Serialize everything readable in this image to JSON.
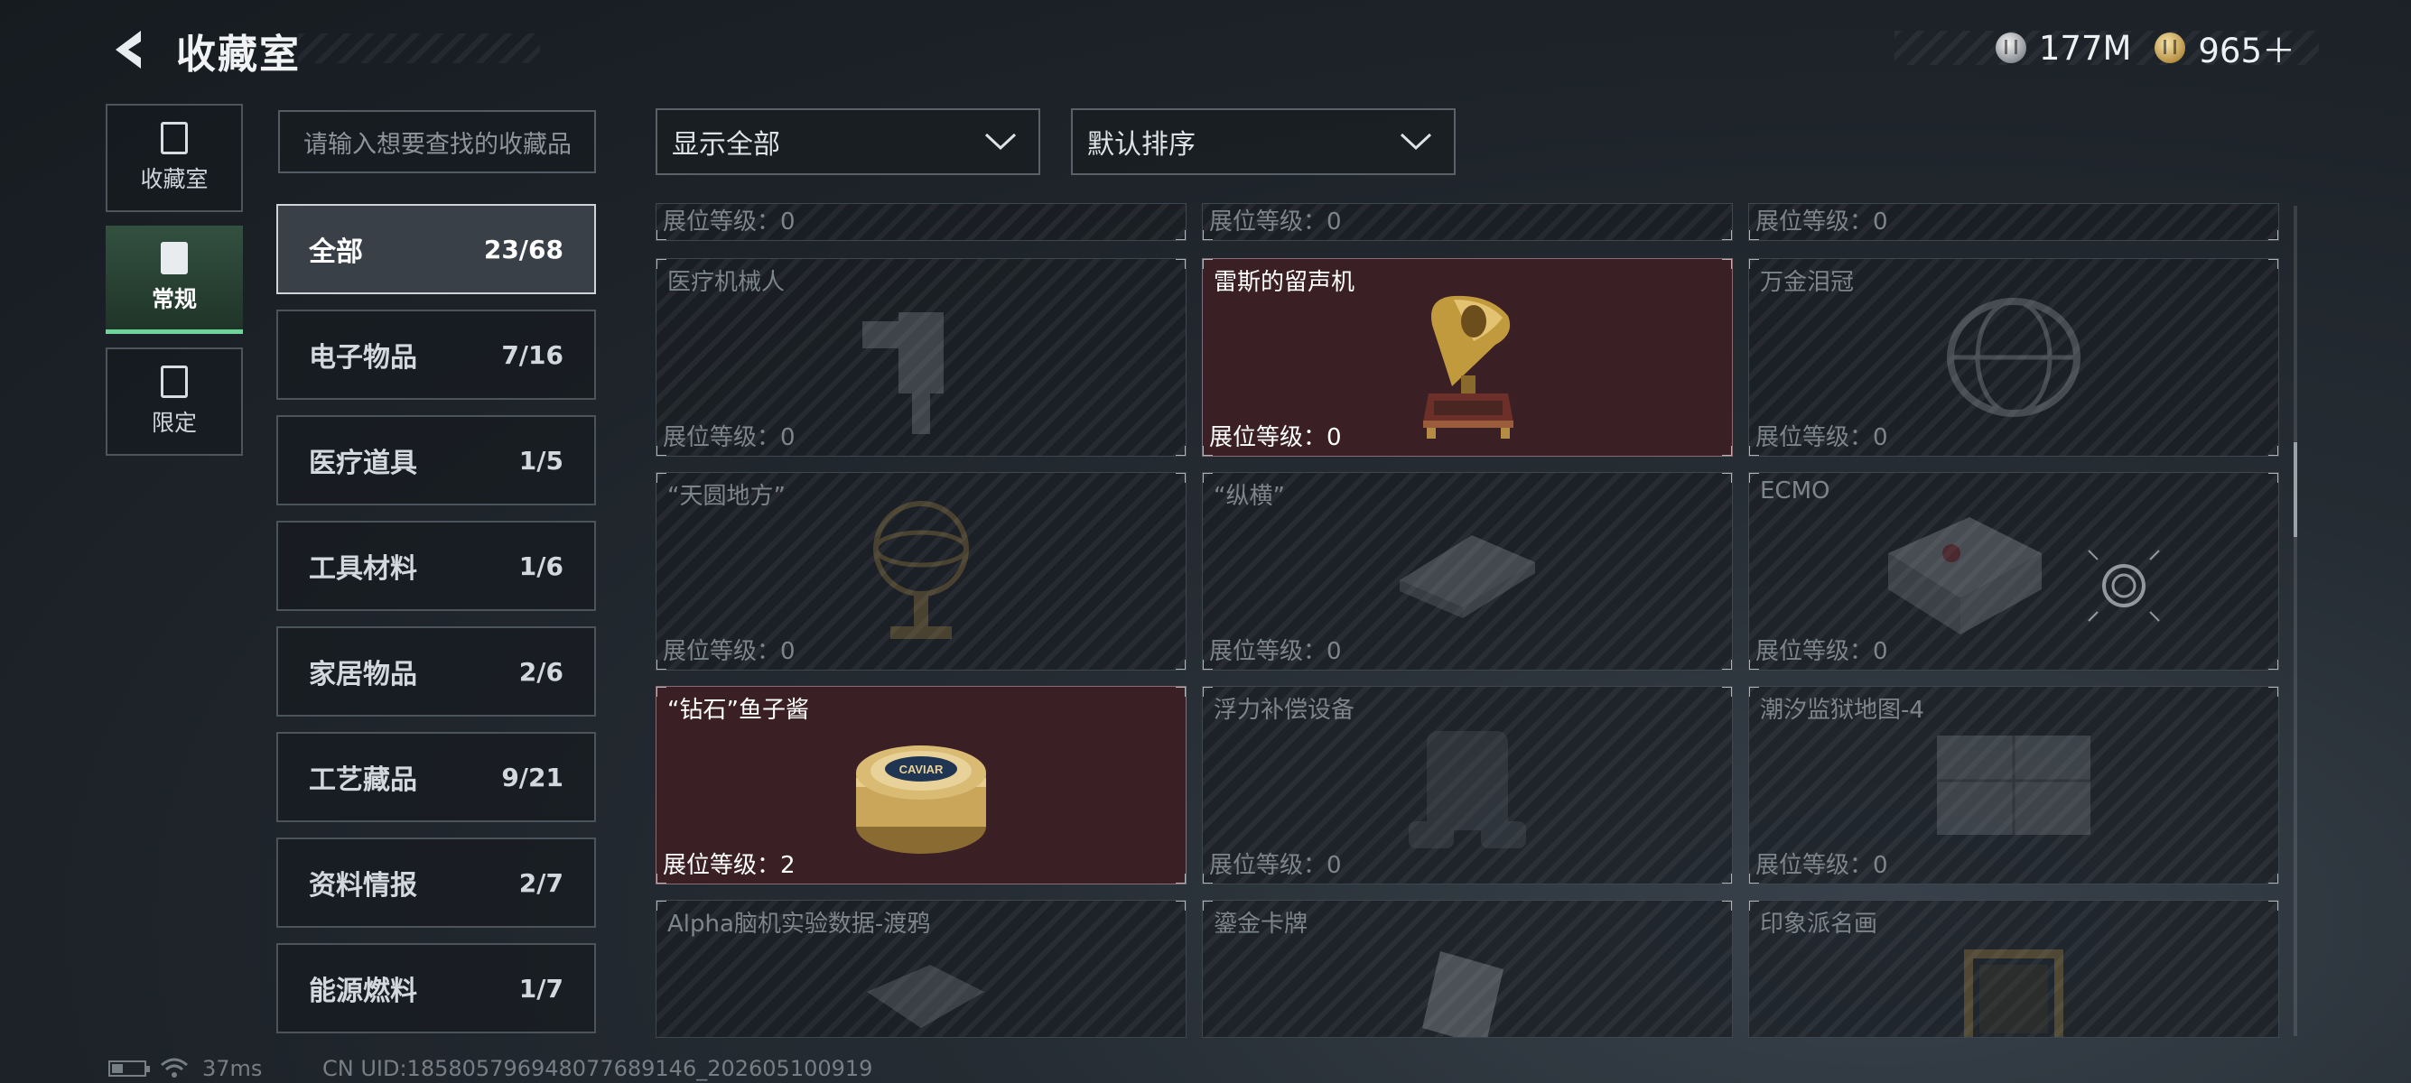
{
  "header": {
    "title": "收藏室",
    "currency": [
      {
        "icon": "silver-coin-icon",
        "value": "177M"
      },
      {
        "icon": "gold-coin-icon",
        "value": "965＋"
      }
    ]
  },
  "rail": [
    {
      "label": "收藏室",
      "icon": "collection-room-icon",
      "active": false
    },
    {
      "label": "常规",
      "icon": "regular-icon",
      "active": true
    },
    {
      "label": "限定",
      "icon": "limited-icon",
      "active": false
    }
  ],
  "search": {
    "placeholder": "请输入想要查找的收藏品"
  },
  "categories": [
    {
      "label": "全部",
      "count": "23/68",
      "active": true
    },
    {
      "label": "电子物品",
      "count": "7/16"
    },
    {
      "label": "医疗道具",
      "count": "1/5"
    },
    {
      "label": "工具材料",
      "count": "1/6"
    },
    {
      "label": "家居物品",
      "count": "2/6"
    },
    {
      "label": "工艺藏品",
      "count": "9/21"
    },
    {
      "label": "资料情报",
      "count": "2/7"
    },
    {
      "label": "能源燃料",
      "count": "1/7"
    }
  ],
  "filters": {
    "display": "显示全部",
    "sort": "默认排序"
  },
  "grid": {
    "partial_row": [
      {
        "level": "展位等级：0"
      },
      {
        "level": "展位等级：0"
      },
      {
        "level": "展位等级：0"
      }
    ],
    "rows": [
      [
        {
          "name": "医疗机械人",
          "level": "展位等级：0",
          "owned": false,
          "icon": "medical-robot-icon"
        },
        {
          "name": "雷斯的留声机",
          "level": "展位等级：0",
          "owned": true,
          "icon": "gramophone-icon"
        },
        {
          "name": "万金泪冠",
          "level": "展位等级：0",
          "owned": false,
          "icon": "crown-icon"
        }
      ],
      [
        {
          "name": "“天圆地方”",
          "level": "展位等级：0",
          "owned": false,
          "icon": "armillary-sphere-icon"
        },
        {
          "name": "“纵横”",
          "level": "展位等级：0",
          "owned": false,
          "icon": "chess-board-icon"
        },
        {
          "name": "ECMO",
          "level": "展位等级：0",
          "owned": false,
          "icon": "ecmo-machine-icon"
        }
      ],
      [
        {
          "name": "“钻石”鱼子酱",
          "level": "展位等级：2",
          "owned": true,
          "icon": "caviar-tin-icon",
          "tin_text": "CAVIAR"
        },
        {
          "name": "浮力补偿设备",
          "level": "展位等级：0",
          "owned": false,
          "icon": "buoyancy-device-icon"
        },
        {
          "name": "潮汐监狱地图-4",
          "level": "展位等级：0",
          "owned": false,
          "icon": "map-icon"
        }
      ],
      [
        {
          "name": "Alpha脑机实验数据-渡鸦",
          "owned": false,
          "icon": "data-device-icon"
        },
        {
          "name": "鎏金卡牌",
          "owned": false,
          "icon": "gilded-card-icon"
        },
        {
          "name": "印象派名画",
          "owned": false,
          "icon": "painting-icon"
        }
      ]
    ]
  },
  "footer": {
    "ping": "37ms",
    "uid": "CN UID:185805796948077689146_202605100919"
  }
}
